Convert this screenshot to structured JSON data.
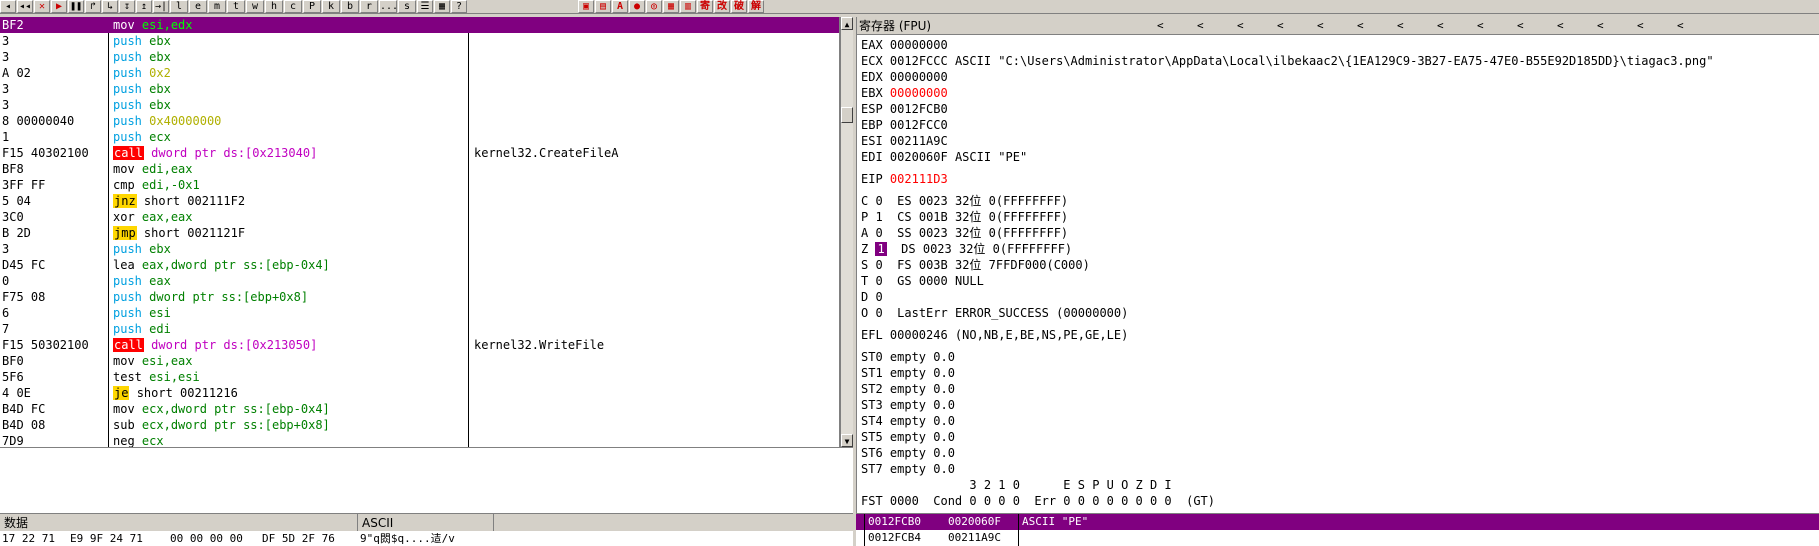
{
  "toolbar": {
    "buttons": [
      "◂",
      "◂◂",
      "✕",
      "▶",
      "❚❚",
      "↱",
      "↳",
      "↧",
      "↥",
      "→|",
      "l",
      "e",
      "m",
      "t",
      "w",
      "h",
      "c",
      "P",
      "k",
      "b",
      "r",
      "...",
      "s",
      "☰",
      "▦",
      "?"
    ],
    "right_buttons": [
      "▣",
      "▤",
      "A",
      "●",
      "◎",
      "▦",
      "▥",
      "寄",
      "改",
      "破",
      "解"
    ]
  },
  "disasm": {
    "rows": [
      {
        "bytes": "BF2",
        "mnem": "mov",
        "mclass": "m-mnem",
        "ops": "esi,edx",
        "oclass": "op-green",
        "comment": "",
        "selected": true
      },
      {
        "bytes": "3",
        "mnem": "push",
        "mclass": "m-blue",
        "ops": "ebx",
        "oclass": "op-green",
        "comment": ""
      },
      {
        "bytes": "3",
        "mnem": "push",
        "mclass": "m-blue",
        "ops": "ebx",
        "oclass": "op-green",
        "comment": ""
      },
      {
        "bytes": "A 02",
        "mnem": "push",
        "mclass": "m-blue",
        "ops": "0x2",
        "oclass": "op-yellow",
        "comment": ""
      },
      {
        "bytes": "3",
        "mnem": "push",
        "mclass": "m-blue",
        "ops": "ebx",
        "oclass": "op-green",
        "comment": ""
      },
      {
        "bytes": "3",
        "mnem": "push",
        "mclass": "m-blue",
        "ops": "ebx",
        "oclass": "op-green",
        "comment": ""
      },
      {
        "bytes": "8 00000040",
        "mnem": "push",
        "mclass": "m-blue",
        "ops": "0x40000000",
        "oclass": "op-yellow",
        "comment": ""
      },
      {
        "bytes": "1",
        "mnem": "push",
        "mclass": "m-blue",
        "ops": "ecx",
        "oclass": "op-green",
        "comment": ""
      },
      {
        "bytes": "F15 40302100",
        "mnem": "call",
        "mclass": "m-call",
        "ops": "dword ptr ds:[0x213040]",
        "oclass": "op-magenta",
        "comment": "kernel32.CreateFileA"
      },
      {
        "bytes": "BF8",
        "mnem": "mov",
        "mclass": "m-mnem",
        "ops": "edi,eax",
        "oclass": "op-green",
        "comment": ""
      },
      {
        "bytes": "3FF FF",
        "mnem": "cmp",
        "mclass": "m-mnem",
        "ops": "edi,-0x1",
        "oclass": "op-green",
        "comment": ""
      },
      {
        "bytes": "5 04",
        "mnem": "jnz",
        "mclass": "m-jcc",
        "ops": "short 002111F2",
        "oclass": "",
        "comment": ""
      },
      {
        "bytes": "3C0",
        "mnem": "xor",
        "mclass": "m-mnem",
        "ops": "eax,eax",
        "oclass": "op-green",
        "comment": ""
      },
      {
        "bytes": "B 2D",
        "mnem": "jmp",
        "mclass": "m-jcc",
        "ops": "short 0021121F",
        "oclass": "",
        "comment": ""
      },
      {
        "bytes": "3",
        "mnem": "push",
        "mclass": "m-blue",
        "ops": "ebx",
        "oclass": "op-green",
        "comment": ""
      },
      {
        "bytes": "D45 FC",
        "mnem": "lea",
        "mclass": "m-mnem",
        "ops": "eax,dword ptr ss:[ebp-0x4]",
        "oclass": "op-green",
        "comment": ""
      },
      {
        "bytes": "0",
        "mnem": "push",
        "mclass": "m-blue",
        "ops": "eax",
        "oclass": "op-green",
        "comment": ""
      },
      {
        "bytes": "F75 08",
        "mnem": "push",
        "mclass": "m-blue",
        "ops": "dword ptr ss:[ebp+0x8]",
        "oclass": "op-green",
        "comment": ""
      },
      {
        "bytes": "6",
        "mnem": "push",
        "mclass": "m-blue",
        "ops": "esi",
        "oclass": "op-green",
        "comment": ""
      },
      {
        "bytes": "7",
        "mnem": "push",
        "mclass": "m-blue",
        "ops": "edi",
        "oclass": "op-green",
        "comment": ""
      },
      {
        "bytes": "F15 50302100",
        "mnem": "call",
        "mclass": "m-call",
        "ops": "dword ptr ds:[0x213050]",
        "oclass": "op-magenta",
        "comment": "kernel32.WriteFile"
      },
      {
        "bytes": "BF0",
        "mnem": "mov",
        "mclass": "m-mnem",
        "ops": "esi,eax",
        "oclass": "op-green",
        "comment": ""
      },
      {
        "bytes": "5F6",
        "mnem": "test",
        "mclass": "m-mnem",
        "ops": "esi,esi",
        "oclass": "op-green",
        "comment": ""
      },
      {
        "bytes": "4 0E",
        "mnem": "je",
        "mclass": "m-jcc",
        "ops": "short 00211216",
        "oclass": "",
        "comment": ""
      },
      {
        "bytes": "B4D FC",
        "mnem": "mov",
        "mclass": "m-mnem",
        "ops": "ecx,dword ptr ss:[ebp-0x4]",
        "oclass": "op-green",
        "comment": ""
      },
      {
        "bytes": "B4D 08",
        "mnem": "sub",
        "mclass": "m-mnem",
        "ops": "ecx,dword ptr ss:[ebp+0x8]",
        "oclass": "op-green",
        "comment": ""
      },
      {
        "bytes": "7D9",
        "mnem": "neg",
        "mclass": "m-mnem",
        "ops": "ecx",
        "oclass": "op-green",
        "comment": ""
      }
    ]
  },
  "registers": {
    "title": "寄存器 (FPU)",
    "title_arrows": [
      "<",
      "<",
      "<",
      "<",
      "<",
      "<",
      "<",
      "<",
      "<",
      "<",
      "<",
      "<",
      "<",
      "<"
    ],
    "gp": [
      {
        "name": "EAX",
        "value": "00000000",
        "extra": "",
        "red": false
      },
      {
        "name": "ECX",
        "value": "0012FCCC",
        "extra": "ASCII \"C:\\Users\\Administrator\\AppData\\Local\\ilbekaac2\\{1EA129C9-3B27-EA75-47E0-B55E92D185DD}\\tiagac3.png\"",
        "red": false
      },
      {
        "name": "EDX",
        "value": "00000000",
        "extra": "",
        "red": false
      },
      {
        "name": "EBX",
        "value": "00000000",
        "extra": "",
        "red": true
      },
      {
        "name": "ESP",
        "value": "0012FCB0",
        "extra": "",
        "red": false
      },
      {
        "name": "EBP",
        "value": "0012FCC0",
        "extra": "",
        "red": false
      },
      {
        "name": "ESI",
        "value": "00211A9C",
        "extra": "",
        "red": false
      },
      {
        "name": "EDI",
        "value": "0020060F",
        "extra": "ASCII \"PE\"",
        "red": false
      }
    ],
    "eip": {
      "name": "EIP",
      "value": "002111D3"
    },
    "flags": [
      {
        "flag": "C",
        "val": "0",
        "seg": "ES",
        "sel": "0023",
        "bits": "32位",
        "info": "0(FFFFFFFF)",
        "boxed": false
      },
      {
        "flag": "P",
        "val": "1",
        "seg": "CS",
        "sel": "001B",
        "bits": "32位",
        "info": "0(FFFFFFFF)",
        "boxed": false
      },
      {
        "flag": "A",
        "val": "0",
        "seg": "SS",
        "sel": "0023",
        "bits": "32位",
        "info": "0(FFFFFFFF)",
        "boxed": false
      },
      {
        "flag": "Z",
        "val": "1",
        "seg": "DS",
        "sel": "0023",
        "bits": "32位",
        "info": "0(FFFFFFFF)",
        "boxed": true
      },
      {
        "flag": "S",
        "val": "0",
        "seg": "FS",
        "sel": "003B",
        "bits": "32位",
        "info": "7FFDF000(C000)",
        "boxed": false
      },
      {
        "flag": "T",
        "val": "0",
        "seg": "GS",
        "sel": "0000",
        "bits": "",
        "info": "NULL",
        "boxed": false
      },
      {
        "flag": "D",
        "val": "0",
        "seg": "",
        "sel": "",
        "bits": "",
        "info": "",
        "boxed": false
      },
      {
        "flag": "O",
        "val": "0",
        "seg": "LastErr",
        "sel": "",
        "bits": "",
        "info": "ERROR_SUCCESS (00000000)",
        "boxed": false
      }
    ],
    "efl": "EFL 00000246 (NO,NB,E,BE,NS,PE,GE,LE)",
    "fpu": [
      "ST0 empty 0.0",
      "ST1 empty 0.0",
      "ST2 empty 0.0",
      "ST3 empty 0.0",
      "ST4 empty 0.0",
      "ST5 empty 0.0",
      "ST6 empty 0.0",
      "ST7 empty 0.0"
    ],
    "fpu_header": "               3 2 1 0      E S P U O Z D I",
    "fst": "FST 0000  Cond 0 0 0 0  Err 0 0 0 0 0 0 0 0  (GT)"
  },
  "dump": {
    "header_data": "数据",
    "header_ascii": "ASCII",
    "row": {
      "c1": "17 22 71",
      "c2": "E9 9F 24 71",
      "c3": "00 00 00 00",
      "c4": "DF 5D 2F 76",
      "ascii": "9\"q閦$q....迼/v"
    }
  },
  "stack": {
    "rows": [
      {
        "addr": "0012FCB0",
        "val": "0020060F",
        "comment": "ASCII \"PE\"",
        "selected": true
      },
      {
        "addr": "0012FCB4",
        "val": "00211A9C",
        "comment": "",
        "selected": false
      }
    ]
  }
}
